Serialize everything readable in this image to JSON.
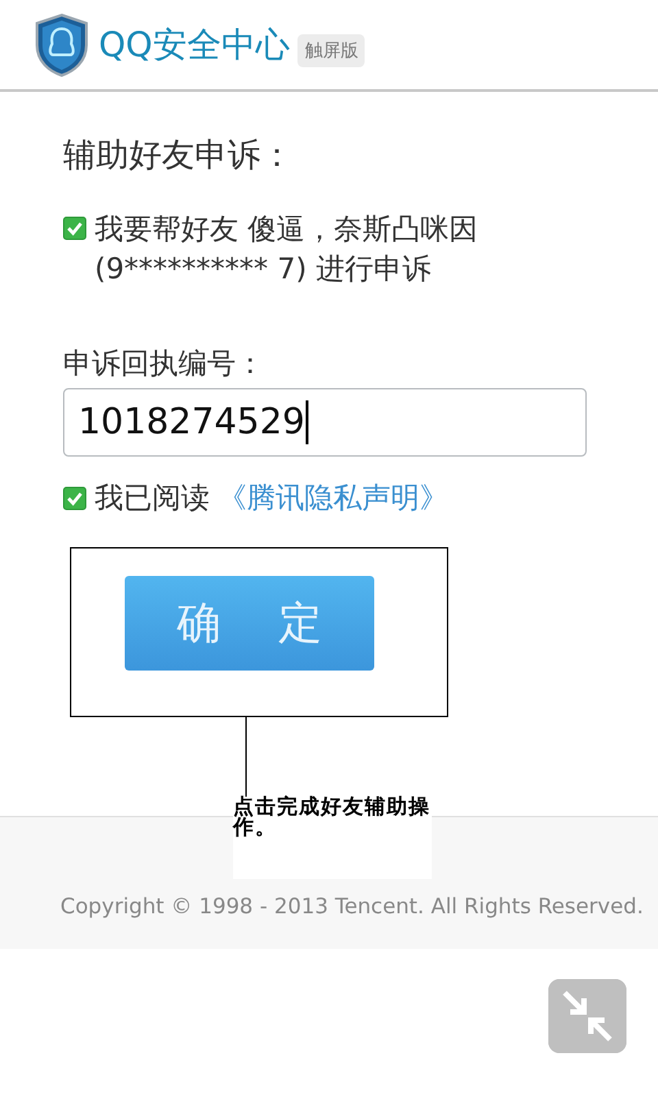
{
  "header": {
    "title": "QQ安全中心",
    "badge": "触屏版"
  },
  "heading": "辅助好友申诉：",
  "friend_consent": {
    "checked": true,
    "text": "我要帮好友 傻逼，奈斯凸咪因 (9********** 7) 进行申诉"
  },
  "receipt_field": {
    "label": "申诉回执编号：",
    "value": "1018274529"
  },
  "agreement": {
    "checked": true,
    "text": "我已阅读",
    "link": "《腾讯隐私声明》"
  },
  "confirm_button": "确 定",
  "annotation": "点击完成好友辅助操作。",
  "footer": "Copyright © 1998 - 2013 Tencent. All Rights Reserved."
}
